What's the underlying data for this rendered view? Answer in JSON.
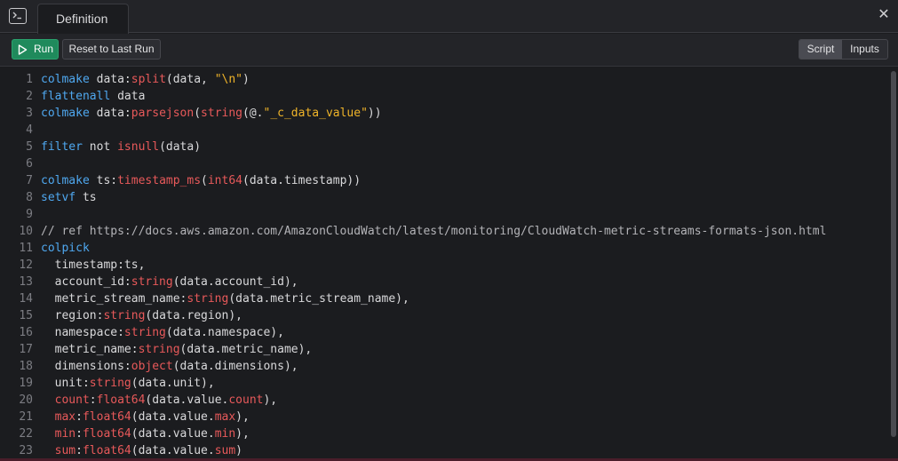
{
  "tab": {
    "label": "Definition"
  },
  "toolbar": {
    "run_label": "Run",
    "reset_label": "Reset to Last Run",
    "segments": [
      "Script",
      "Inputs"
    ],
    "active_segment": "Script"
  },
  "icons": {
    "terminal": "terminal-icon",
    "close": "close-icon",
    "play": "play-icon"
  },
  "colors": {
    "run": "#1f8a5c",
    "keyword": "#4fa8f0",
    "function": "#e8595a",
    "string": "#f0b429"
  },
  "editor": {
    "lines": [
      {
        "n": "1",
        "t": [
          [
            "kw",
            "colmake"
          ],
          [
            "p",
            " data:"
          ],
          [
            "fn",
            "split"
          ],
          [
            "p",
            "(data, "
          ],
          [
            "str",
            "\"\\n\""
          ],
          [
            "p",
            ")"
          ]
        ]
      },
      {
        "n": "2",
        "t": [
          [
            "kw",
            "flattenall"
          ],
          [
            "p",
            " data"
          ]
        ]
      },
      {
        "n": "3",
        "t": [
          [
            "kw",
            "colmake"
          ],
          [
            "p",
            " data:"
          ],
          [
            "fn",
            "parsejson"
          ],
          [
            "p",
            "("
          ],
          [
            "fn",
            "string"
          ],
          [
            "p",
            "(@."
          ],
          [
            "str",
            "\"_c_data_value\""
          ],
          [
            "p",
            "))"
          ]
        ]
      },
      {
        "n": "4",
        "t": []
      },
      {
        "n": "5",
        "t": [
          [
            "kw",
            "filter"
          ],
          [
            "p",
            " not "
          ],
          [
            "fn",
            "isnull"
          ],
          [
            "p",
            "(data)"
          ]
        ]
      },
      {
        "n": "6",
        "t": []
      },
      {
        "n": "7",
        "t": [
          [
            "kw",
            "colmake"
          ],
          [
            "p",
            " ts:"
          ],
          [
            "fn",
            "timestamp_ms"
          ],
          [
            "p",
            "("
          ],
          [
            "fn",
            "int64"
          ],
          [
            "p",
            "(data.timestamp))"
          ]
        ]
      },
      {
        "n": "8",
        "t": [
          [
            "kw",
            "setvf"
          ],
          [
            "p",
            " ts"
          ]
        ]
      },
      {
        "n": "9",
        "t": []
      },
      {
        "n": "10",
        "t": [
          [
            "cm",
            "// ref https://docs.aws.amazon.com/AmazonCloudWatch/latest/monitoring/CloudWatch-metric-streams-formats-json.html"
          ]
        ]
      },
      {
        "n": "11",
        "t": [
          [
            "kw",
            "colpick"
          ]
        ]
      },
      {
        "n": "12",
        "t": [
          [
            "p",
            "  timestamp:ts,"
          ]
        ]
      },
      {
        "n": "13",
        "t": [
          [
            "p",
            "  account_id:"
          ],
          [
            "fn",
            "string"
          ],
          [
            "p",
            "(data.account_id),"
          ]
        ]
      },
      {
        "n": "14",
        "t": [
          [
            "p",
            "  metric_stream_name:"
          ],
          [
            "fn",
            "string"
          ],
          [
            "p",
            "(data.metric_stream_name),"
          ]
        ]
      },
      {
        "n": "15",
        "t": [
          [
            "p",
            "  region:"
          ],
          [
            "fn",
            "string"
          ],
          [
            "p",
            "(data.region),"
          ]
        ]
      },
      {
        "n": "16",
        "t": [
          [
            "p",
            "  namespace:"
          ],
          [
            "fn",
            "string"
          ],
          [
            "p",
            "(data.namespace),"
          ]
        ]
      },
      {
        "n": "17",
        "t": [
          [
            "p",
            "  metric_name:"
          ],
          [
            "fn",
            "string"
          ],
          [
            "p",
            "(data.metric_name),"
          ]
        ]
      },
      {
        "n": "18",
        "t": [
          [
            "p",
            "  dimensions:"
          ],
          [
            "fn",
            "object"
          ],
          [
            "p",
            "(data.dimensions),"
          ]
        ]
      },
      {
        "n": "19",
        "t": [
          [
            "p",
            "  unit:"
          ],
          [
            "fn",
            "string"
          ],
          [
            "p",
            "(data.unit),"
          ]
        ]
      },
      {
        "n": "20",
        "t": [
          [
            "p",
            "  "
          ],
          [
            "fn",
            "count"
          ],
          [
            "p",
            ":"
          ],
          [
            "fn",
            "float64"
          ],
          [
            "p",
            "(data.value."
          ],
          [
            "fn",
            "count"
          ],
          [
            "p",
            "),"
          ]
        ]
      },
      {
        "n": "21",
        "t": [
          [
            "p",
            "  "
          ],
          [
            "fn",
            "max"
          ],
          [
            "p",
            ":"
          ],
          [
            "fn",
            "float64"
          ],
          [
            "p",
            "(data.value."
          ],
          [
            "fn",
            "max"
          ],
          [
            "p",
            "),"
          ]
        ]
      },
      {
        "n": "22",
        "t": [
          [
            "p",
            "  "
          ],
          [
            "fn",
            "min"
          ],
          [
            "p",
            ":"
          ],
          [
            "fn",
            "float64"
          ],
          [
            "p",
            "(data.value."
          ],
          [
            "fn",
            "min"
          ],
          [
            "p",
            "),"
          ]
        ]
      },
      {
        "n": "23",
        "t": [
          [
            "p",
            "  "
          ],
          [
            "fn",
            "sum"
          ],
          [
            "p",
            ":"
          ],
          [
            "fn",
            "float64"
          ],
          [
            "p",
            "(data.value."
          ],
          [
            "fn",
            "sum"
          ],
          [
            "p",
            ")"
          ]
        ]
      }
    ]
  }
}
